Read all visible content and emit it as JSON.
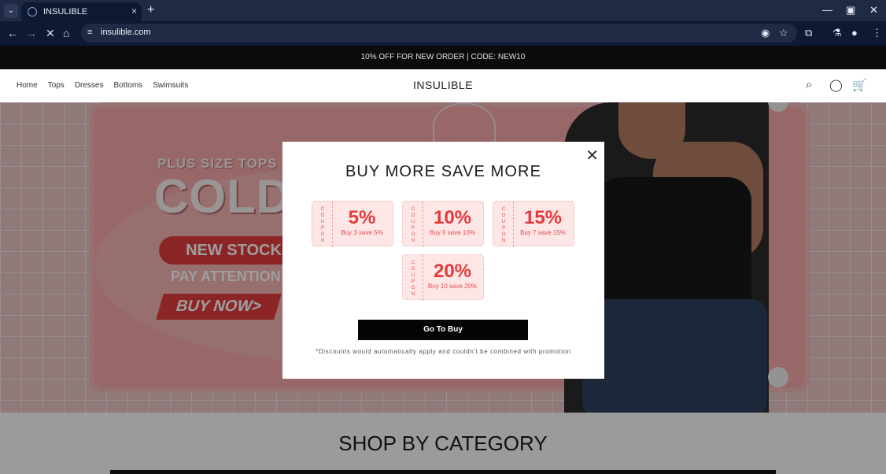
{
  "browser": {
    "tab_title": "INSULIBLE",
    "url": "insulible.com"
  },
  "site": {
    "announcement": "10% OFF FOR NEW ORDER | CODE: NEW10",
    "brand": "INSULIBLE",
    "nav": [
      "Home",
      "Tops",
      "Dresses",
      "Bottoms",
      "Swimsuits"
    ]
  },
  "hero": {
    "line1": "PLUS SIZE TOPS",
    "line2": "COLD SH",
    "line3": "NEW STOCK",
    "line4": "PAY ATTENTION TO",
    "line5": "BUY NOW>"
  },
  "modal": {
    "title": "BUY MORE SAVE MORE",
    "coupon_label": [
      "C",
      "O",
      "U",
      "P",
      "O",
      "N"
    ],
    "coupons": [
      {
        "percent": "5%",
        "desc": "Buy 3 save 5%"
      },
      {
        "percent": "10%",
        "desc": "Buy 5 save 10%"
      },
      {
        "percent": "15%",
        "desc": "Buy 7 save 15%"
      },
      {
        "percent": "20%",
        "desc": "Buy 10 save 20%"
      }
    ],
    "button": "Go To Buy",
    "note": "*Discounts would automatically apply and couldn't be combined with promotion"
  },
  "section": {
    "title": "SHOP BY CATEGORY"
  },
  "icons": {
    "search": "search-icon",
    "account": "account-icon",
    "cart": "cart-icon",
    "close": "close-icon"
  }
}
